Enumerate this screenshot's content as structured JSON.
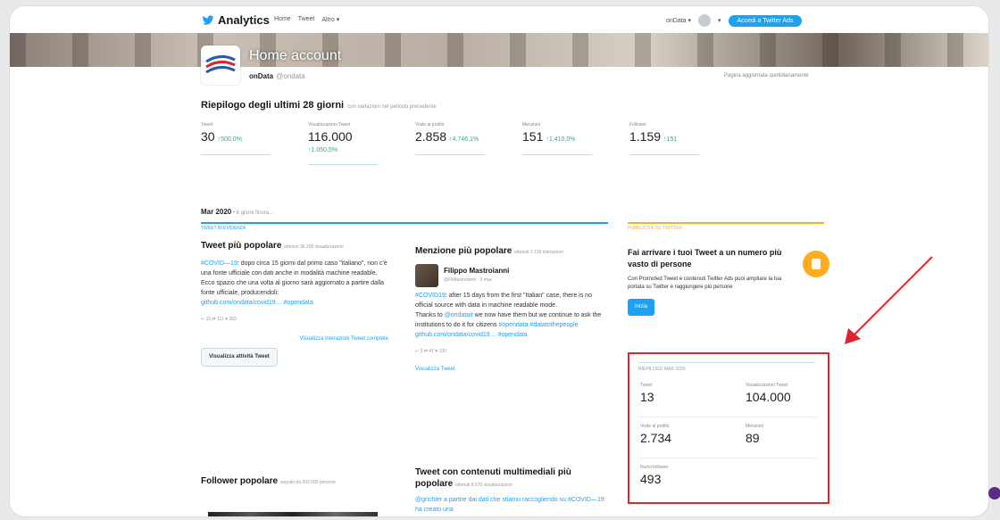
{
  "nav": {
    "brand": "Analytics",
    "links": [
      "Home",
      "Tweet",
      "Altro ▾"
    ],
    "account_menu": "onData ▾",
    "ads_button": "Accedi a Twitter Ads"
  },
  "account": {
    "title": "Home account",
    "name": "onData",
    "handle": "@ondata",
    "updated_note": "Pagina aggiornata quotidianamente"
  },
  "summary": {
    "title": "Riepilogo degli ultimi 28 giorni",
    "subtitle": "con variazioni nel periodo precedente",
    "stats": [
      {
        "label": "Tweet",
        "value": "30",
        "change": "↑500,0%"
      },
      {
        "label": "Visualizzazioni Tweet",
        "value": "116.000",
        "change": "↑1.050,5%"
      },
      {
        "label": "Visite al profilo",
        "value": "2.858",
        "change": "↑4.746,1%"
      },
      {
        "label": "Menzioni",
        "value": "151",
        "change": "↑1.410,0%"
      },
      {
        "label": "Follower",
        "value": "1.159",
        "change": "↑151"
      }
    ]
  },
  "month": {
    "title": "Mar 2020",
    "note": " • 6 giorni finora...",
    "highlights_label": "TWEET IN EVIDENZA",
    "promo_label": "PUBBLICITÀ SU TWITTER"
  },
  "top_tweet": {
    "title": "Tweet più popolare",
    "meta": "ottenuti 36.200 visualizzazioni",
    "hashtag": "#COVID—19",
    "text_1": ": dopo circa 15 giorni dal primo caso \"italiano\", non c'è una fonte ufficiale con dati anche in modalità machine readable.",
    "text_2": "Ecco spazio che una volta al giorno sarà aggiornato a partire dalla fonte ufficiale, producendoli:",
    "link": "github.com/ondata/covid19…",
    "tag": "#opendata",
    "icons": "↩ 10   ⇄ 111   ♥ 260",
    "activity_link": "Visualizza interazioni Tweet complete",
    "activity_button": "Visualizza attività Tweet"
  },
  "top_mention": {
    "title": "Menzione più popolare",
    "meta": "ottenuti 2.136 interazioni",
    "author": "Filippo Mastroianni",
    "author_handle": "@FilMastroianni · 3 mar",
    "hashtag": "#COVID19",
    "text_1": ": after 15 days from the first \"Italian\" case, there is no official source with data in machine readable mode.",
    "text_2": "Thanks to ",
    "mention": "@ondatait",
    "text_3": " we now have them but we continue to ask the institutions to do it for citizens ",
    "tags": "#opendata #datatothepeople",
    "link": "github.com/ondata/covid19… #opendata",
    "icons": "↩ 3   ⇄ 47   ♥ 130",
    "view_link": "Visualizza Tweet"
  },
  "top_follower": {
    "title": "Follower popolare",
    "meta": "seguito da 203.000 persone"
  },
  "top_media": {
    "title": "Tweet con contenuti multimediali più popolare",
    "meta": "ottenuti 8.670 visualizzazioni",
    "text": "@grichler a partire dai dati che stiamo raccogliendo su #COVID—19 ha creato una"
  },
  "promo": {
    "title": "Fai arrivare i tuoi Tweet a un numero più vasto di persone",
    "text": "Con Promoted Tweet e contenuti Twitter Ads puoi ampliare la tua portata su Twitter e raggiungere più persone",
    "button": "Inizia"
  },
  "month_summary": {
    "header": "RIEPILOGO MAR 2020",
    "cells": [
      {
        "label": "Tweet",
        "value": "13"
      },
      {
        "label": "Visualizzazioni Tweet",
        "value": "104.000"
      },
      {
        "label": "Visite al profilo",
        "value": "2.734"
      },
      {
        "label": "Menzioni",
        "value": "89"
      },
      {
        "label": "Nuovi follower",
        "value": "493"
      }
    ]
  },
  "colors": {
    "accent": "#1da1f2",
    "highlight": "#e0232e",
    "promo": "#ffad1f",
    "positive": "#17bf63"
  }
}
